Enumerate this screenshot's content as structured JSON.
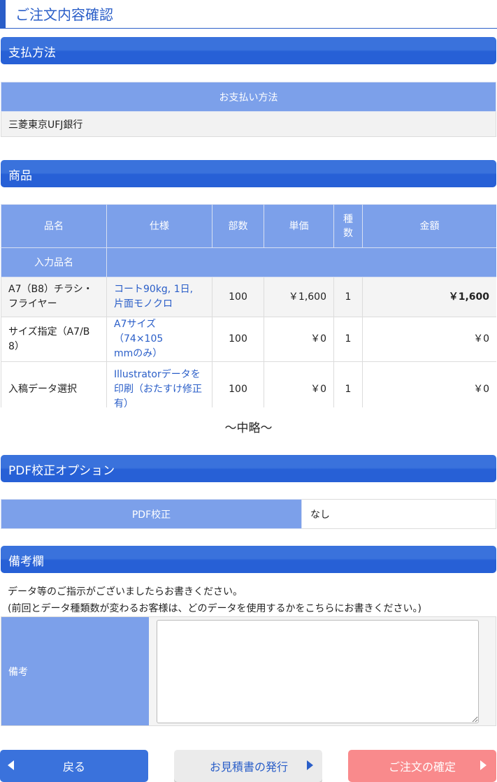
{
  "page_title": "ご注文内容確認",
  "payment": {
    "heading": "支払方法",
    "column_header": "お支払い方法",
    "value": "三菱東京UFJ銀行"
  },
  "products": {
    "heading": "商品",
    "headers": {
      "name": "品名",
      "spec": "仕様",
      "copies": "部数",
      "unit_price": "単価",
      "kinds_1": "種",
      "kinds_2": "数",
      "amount": "金額",
      "input_name": "入力品名"
    },
    "rows": [
      {
        "name_1": "A7（B8）チラシ・",
        "name_2": "フライヤー",
        "spec_1": "コート90kg, 1日,",
        "spec_2": "片面モノクロ",
        "spec_3": "",
        "copies": "100",
        "unit_price": "￥1,600",
        "kinds": "1",
        "amount": "￥1,600"
      },
      {
        "name_1": "サイズ指定（A7/B",
        "name_2": "8）",
        "spec_1": "A7サイズ（74×105",
        "spec_2": "mmのみ）",
        "spec_3": "",
        "copies": "100",
        "unit_price": "￥0",
        "kinds": "1",
        "amount": "￥0"
      },
      {
        "name_1": "入稿データ選択",
        "name_2": "",
        "spec_1": "Illustratorデータを",
        "spec_2": "印刷（おたすけ修正",
        "spec_3": "有）",
        "copies": "100",
        "unit_price": "￥0",
        "kinds": "1",
        "amount": "￥0"
      }
    ]
  },
  "omitted_text": "～中略～",
  "pdf_option": {
    "heading": "PDF校正オプション",
    "label": "PDF校正",
    "value": "なし"
  },
  "remarks": {
    "heading": "備考欄",
    "instruction_1": "データ等のご指示がございましたらお書きください。",
    "instruction_2": "(前回とデータ種類数が変わるお客様は、どのデータを使用するかをこちらにお書きください。)",
    "label": "備考",
    "value": ""
  },
  "buttons": {
    "back": "戻る",
    "quote": "お見積書の発行",
    "confirm": "ご注文の確定"
  },
  "colors": {
    "accent": "#2a5ec8",
    "header_bg": "#3a72dc",
    "table_header": "#7ca0ea",
    "confirm_button": "#f98a8c"
  }
}
